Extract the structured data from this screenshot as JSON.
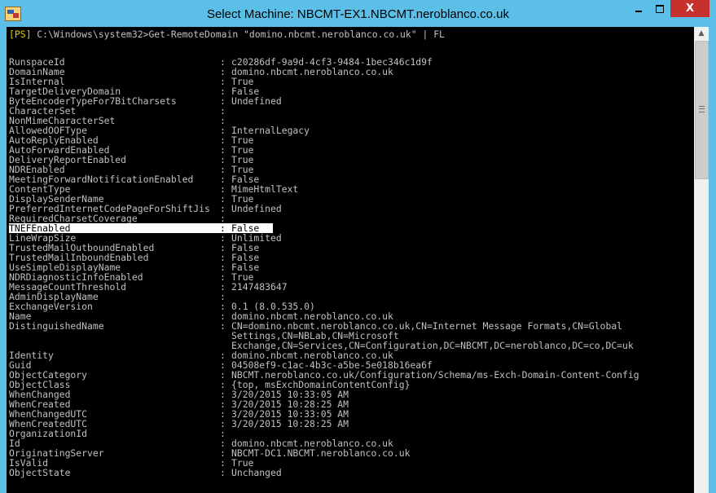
{
  "window": {
    "title": "Select Machine: NBCMT-EX1.NBCMT.neroblanco.co.uk",
    "minimize_label": "",
    "maximize_label": "",
    "close_label": "X"
  },
  "console": {
    "prompt_tag": "[PS]",
    "command": " C:\\Windows\\system32>Get-RemoteDomain \"domino.nbcmt.neroblanco.co.uk\" | FL",
    "separator": ":",
    "properties": [
      {
        "name": "RunspaceId",
        "value": "c20286df-9a9d-4cf3-9484-1bec346c1d9f"
      },
      {
        "name": "DomainName",
        "value": "domino.nbcmt.neroblanco.co.uk"
      },
      {
        "name": "IsInternal",
        "value": "True"
      },
      {
        "name": "TargetDeliveryDomain",
        "value": "False"
      },
      {
        "name": "ByteEncoderTypeFor7BitCharsets",
        "value": "Undefined"
      },
      {
        "name": "CharacterSet",
        "value": ""
      },
      {
        "name": "NonMimeCharacterSet",
        "value": ""
      },
      {
        "name": "AllowedOOFType",
        "value": "InternalLegacy"
      },
      {
        "name": "AutoReplyEnabled",
        "value": "True"
      },
      {
        "name": "AutoForwardEnabled",
        "value": "True"
      },
      {
        "name": "DeliveryReportEnabled",
        "value": "True"
      },
      {
        "name": "NDREnabled",
        "value": "True"
      },
      {
        "name": "MeetingForwardNotificationEnabled",
        "value": "False"
      },
      {
        "name": "ContentType",
        "value": "MimeHtmlText"
      },
      {
        "name": "DisplaySenderName",
        "value": "True"
      },
      {
        "name": "PreferredInternetCodePageForShiftJis",
        "value": "Undefined"
      },
      {
        "name": "RequiredCharsetCoverage",
        "value": ""
      },
      {
        "name": "TNEFEnabled",
        "value": "False",
        "highlighted": true
      },
      {
        "name": "LineWrapSize",
        "value": "Unlimited"
      },
      {
        "name": "TrustedMailOutboundEnabled",
        "value": "False"
      },
      {
        "name": "TrustedMailInboundEnabled",
        "value": "False"
      },
      {
        "name": "UseSimpleDisplayName",
        "value": "False"
      },
      {
        "name": "NDRDiagnosticInfoEnabled",
        "value": "True"
      },
      {
        "name": "MessageCountThreshold",
        "value": "2147483647"
      },
      {
        "name": "AdminDisplayName",
        "value": ""
      },
      {
        "name": "ExchangeVersion",
        "value": "0.1 (8.0.535.0)"
      },
      {
        "name": "Name",
        "value": "domino.nbcmt.neroblanco.co.uk"
      },
      {
        "name": "DistinguishedName",
        "value": "CN=domino.nbcmt.neroblanco.co.uk,CN=Internet Message Formats,CN=Global"
      },
      {
        "name": "",
        "value": "Settings,CN=NBLab,CN=Microsoft",
        "continuation": true
      },
      {
        "name": "",
        "value": "Exchange,CN=Services,CN=Configuration,DC=NBCMT,DC=neroblanco,DC=co,DC=uk",
        "continuation": true
      },
      {
        "name": "Identity",
        "value": "domino.nbcmt.neroblanco.co.uk"
      },
      {
        "name": "Guid",
        "value": "04508ef9-c1ac-4b3c-a5be-5e018b16ea6f"
      },
      {
        "name": "ObjectCategory",
        "value": "NBCMT.neroblanco.co.uk/Configuration/Schema/ms-Exch-Domain-Content-Config"
      },
      {
        "name": "ObjectClass",
        "value": "{top, msExchDomainContentConfig}"
      },
      {
        "name": "WhenChanged",
        "value": "3/20/2015 10:33:05 AM"
      },
      {
        "name": "WhenCreated",
        "value": "3/20/2015 10:28:25 AM"
      },
      {
        "name": "WhenChangedUTC",
        "value": "3/20/2015 10:33:05 AM"
      },
      {
        "name": "WhenCreatedUTC",
        "value": "3/20/2015 10:28:25 AM"
      },
      {
        "name": "OrganizationId",
        "value": ""
      },
      {
        "name": "Id",
        "value": "domino.nbcmt.neroblanco.co.uk"
      },
      {
        "name": "OriginatingServer",
        "value": "NBCMT-DC1.NBCMT.neroblanco.co.uk"
      },
      {
        "name": "IsValid",
        "value": "True"
      },
      {
        "name": "ObjectState",
        "value": "Unchanged"
      }
    ]
  },
  "scrollbar": {
    "up_arrow_icon": "triangle-up-icon",
    "grip_icon": "grip-lines-icon"
  },
  "colors": {
    "frame": "#5bbfe8",
    "console_bg": "#000000",
    "console_text": "#c0c0c0",
    "prompt_tag": "#e0d000",
    "close_button": "#c7312b",
    "highlight_bg": "#ffffff"
  }
}
